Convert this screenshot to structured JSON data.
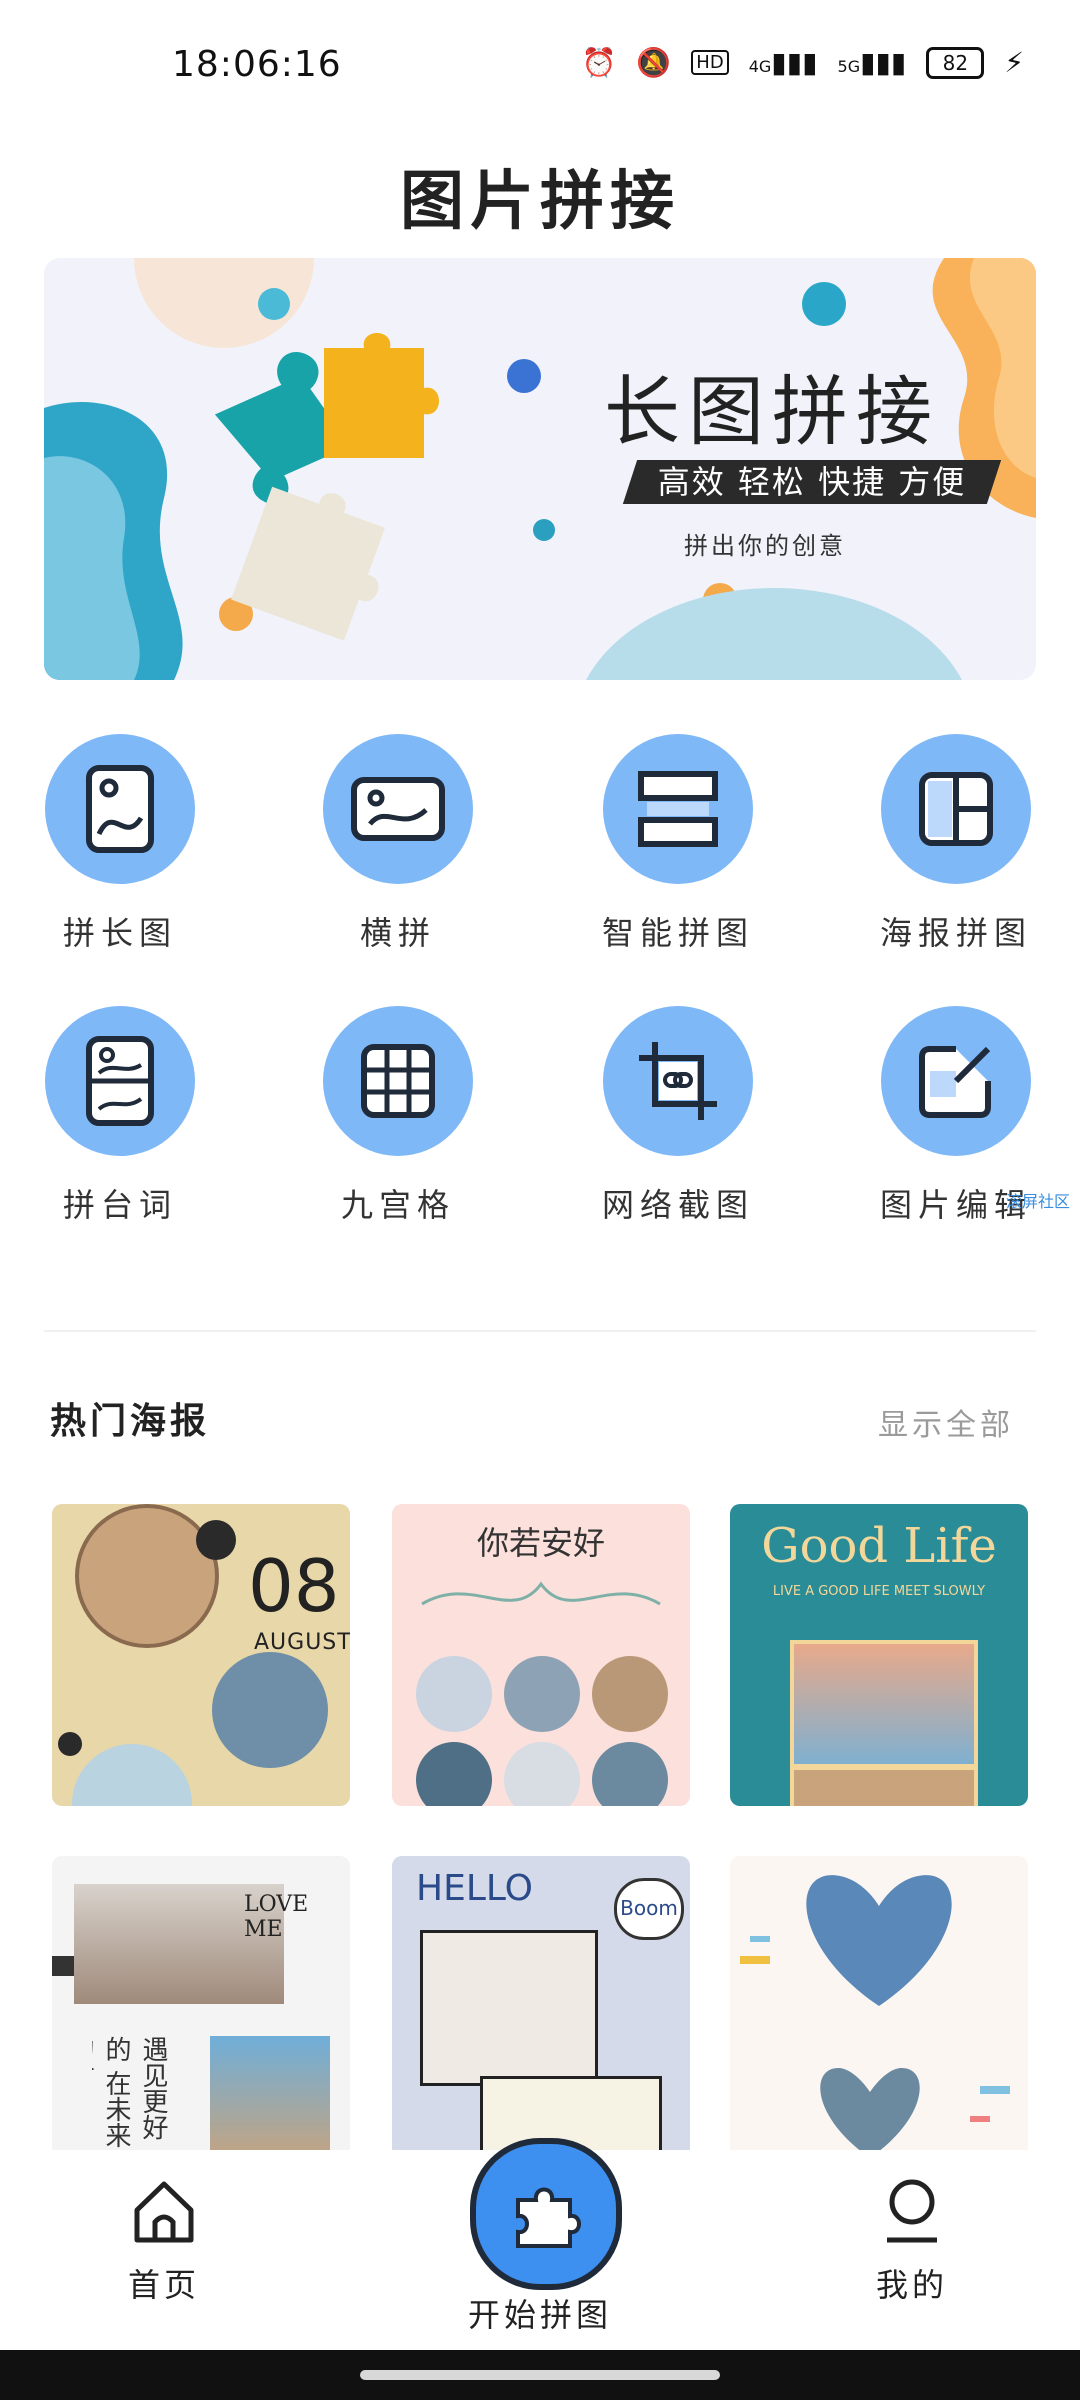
{
  "status": {
    "time": "18:06:16",
    "battery": "82",
    "signal1": "4G",
    "signal2": "5G",
    "hd": "HD"
  },
  "header": {
    "title": "图片拼接"
  },
  "banner": {
    "title": "长图拼接",
    "tagline": "高效 轻松 快捷 方便",
    "subtitle": "拼出你的创意"
  },
  "tools": [
    {
      "label": "拼长图",
      "icon": "long-image-icon"
    },
    {
      "label": "横拼",
      "icon": "horizontal-stitch-icon"
    },
    {
      "label": "智能拼图",
      "icon": "smart-collage-icon"
    },
    {
      "label": "海报拼图",
      "icon": "poster-collage-icon"
    },
    {
      "label": "拼台词",
      "icon": "subtitle-stitch-icon"
    },
    {
      "label": "九宫格",
      "icon": "grid-nine-icon"
    },
    {
      "label": "网络截图",
      "icon": "web-screenshot-icon"
    },
    {
      "label": "图片编辑",
      "icon": "image-edit-icon"
    }
  ],
  "watermark": "滚屏社区",
  "section": {
    "title": "热门海报",
    "show_all": "显示全部"
  },
  "posters": [
    {
      "day": "08",
      "month": "AUGUST"
    },
    {
      "title": "你若安好"
    },
    {
      "title": "Good Life",
      "subtitle": "LIVE A GOOD LIFE MEET SLOWLY"
    },
    {
      "title": "LOVE ME",
      "vertical": "遇见更好的 在未来的时"
    },
    {
      "title": "HELLO",
      "badge": "Boom"
    },
    {
      "title": ""
    }
  ],
  "tabbar": {
    "home": "首页",
    "start": "开始拼图",
    "mine": "我的"
  },
  "colors": {
    "accent": "#3d8ff0",
    "tool_circle": "#7fb8f7"
  }
}
